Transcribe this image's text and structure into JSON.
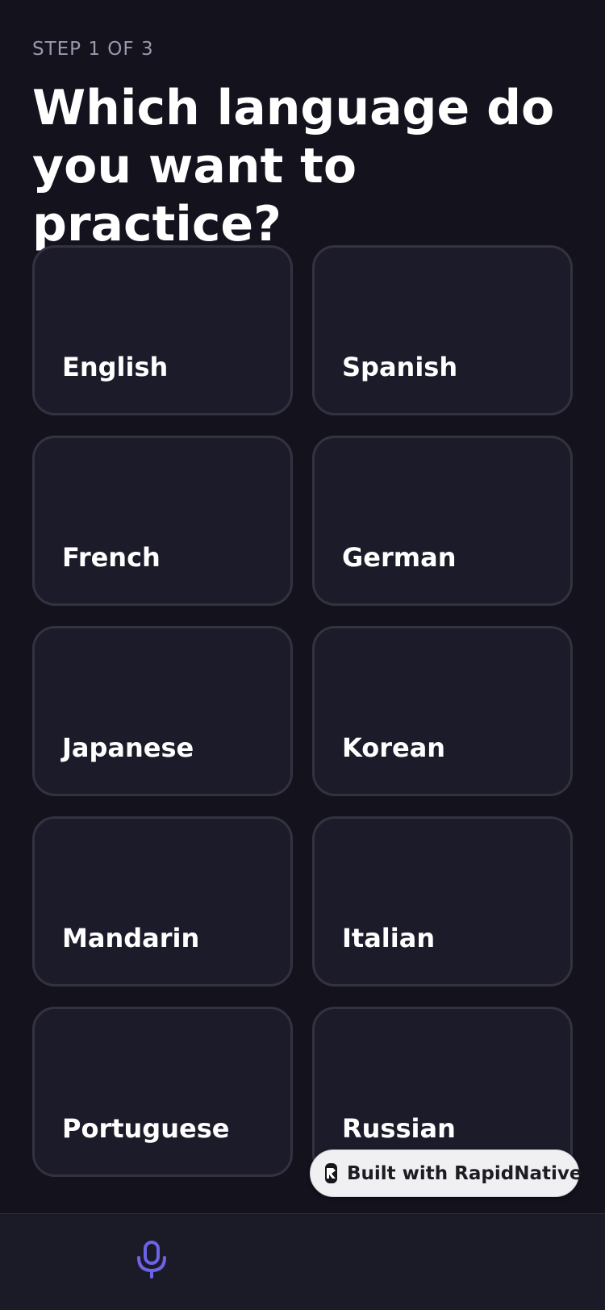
{
  "header": {
    "step": "STEP 1 OF 3",
    "title": "Which language do you want to practice?"
  },
  "languages": [
    {
      "label": "English"
    },
    {
      "label": "Spanish"
    },
    {
      "label": "French"
    },
    {
      "label": "German"
    },
    {
      "label": "Japanese"
    },
    {
      "label": "Korean"
    },
    {
      "label": "Mandarin"
    },
    {
      "label": "Italian"
    },
    {
      "label": "Portuguese"
    },
    {
      "label": "Russian"
    }
  ],
  "badge": {
    "text": "Built with RapidNative",
    "icon": "rapidnative-logo-icon"
  },
  "tabbar": {
    "tabs": [
      {
        "icon": "microphone-icon",
        "label": "",
        "active": true
      },
      {
        "icon": "",
        "label": "",
        "active": false
      }
    ],
    "accent_color": "#6c63e8"
  }
}
